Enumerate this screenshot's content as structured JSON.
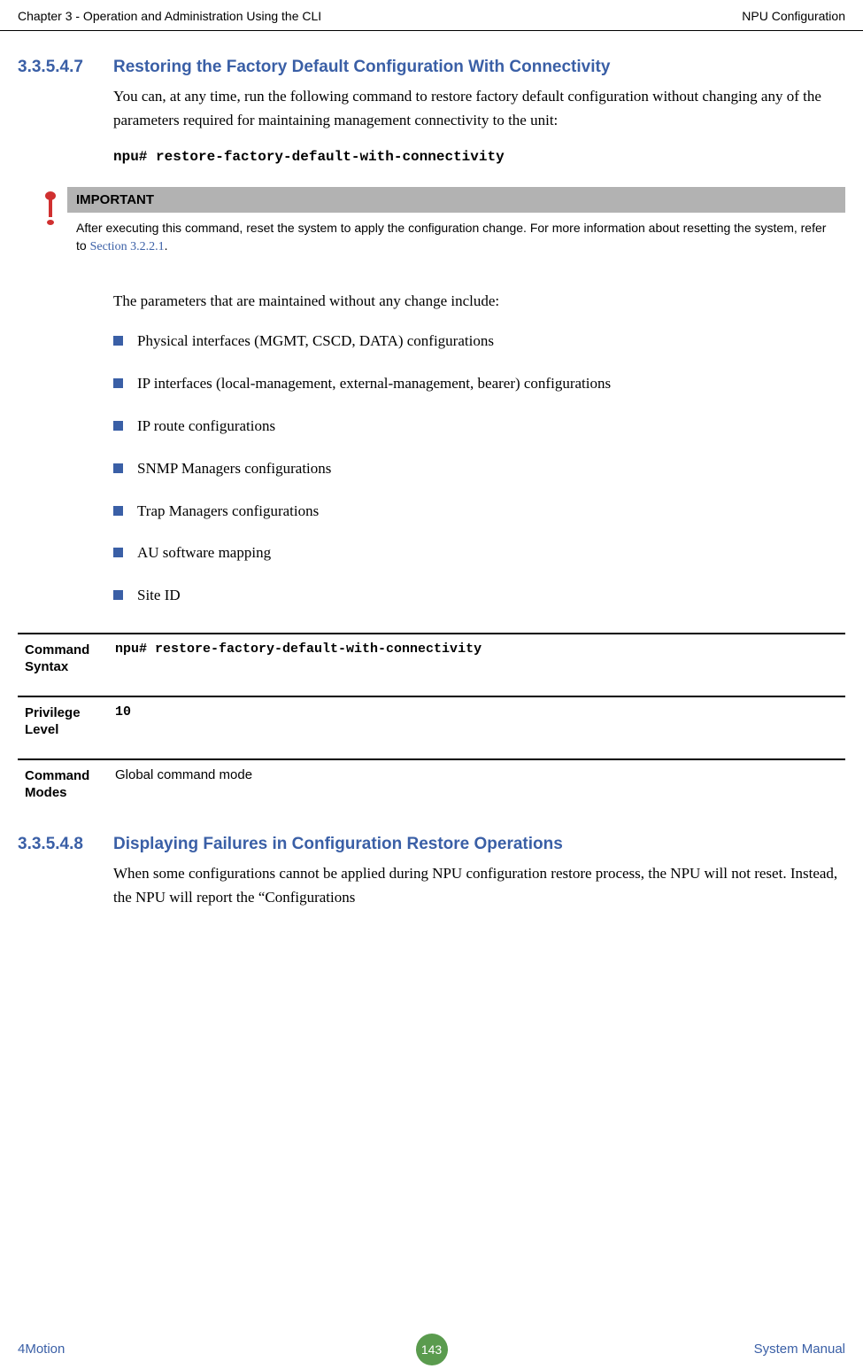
{
  "header": {
    "left": "Chapter 3 - Operation and Administration Using the CLI",
    "right": "NPU Configuration"
  },
  "section1": {
    "number": "3.3.5.4.7",
    "title": "Restoring the Factory Default Configuration With Connectivity",
    "para1": "You can, at any time, run the following command to restore factory default configuration without changing any of the parameters required for maintaining management connectivity to the unit:",
    "command": "npu# restore-factory-default-with-connectivity",
    "important_label": "IMPORTANT",
    "important_text_a": "After executing this command, reset the system to apply the configuration change. For more information about resetting the system, refer to ",
    "important_link": "Section 3.2.2.1",
    "important_text_b": ".",
    "para2": "The parameters that are maintained without any change include:",
    "bullets": [
      "Physical interfaces (MGMT, CSCD, DATA) configurations",
      "IP interfaces (local-management, external-management, bearer) configurations",
      "IP route configurations",
      "SNMP Managers configurations",
      "Trap Managers configurations",
      "AU software mapping",
      "Site ID"
    ]
  },
  "table": {
    "rows": [
      {
        "label": "Command Syntax",
        "value": "npu# restore-factory-default-with-connectivity",
        "mono": true
      },
      {
        "label": "Privilege Level",
        "value": "10",
        "mono": true
      },
      {
        "label": "Command Modes",
        "value": "Global command mode",
        "mono": false
      }
    ]
  },
  "section2": {
    "number": "3.3.5.4.8",
    "title": "Displaying Failures in Configuration Restore Operations",
    "para1": "When some configurations cannot be applied during NPU configuration restore process, the NPU will not reset. Instead, the NPU will report the “Configurations"
  },
  "footer": {
    "left": "4Motion",
    "page": "143",
    "right": "System Manual"
  }
}
